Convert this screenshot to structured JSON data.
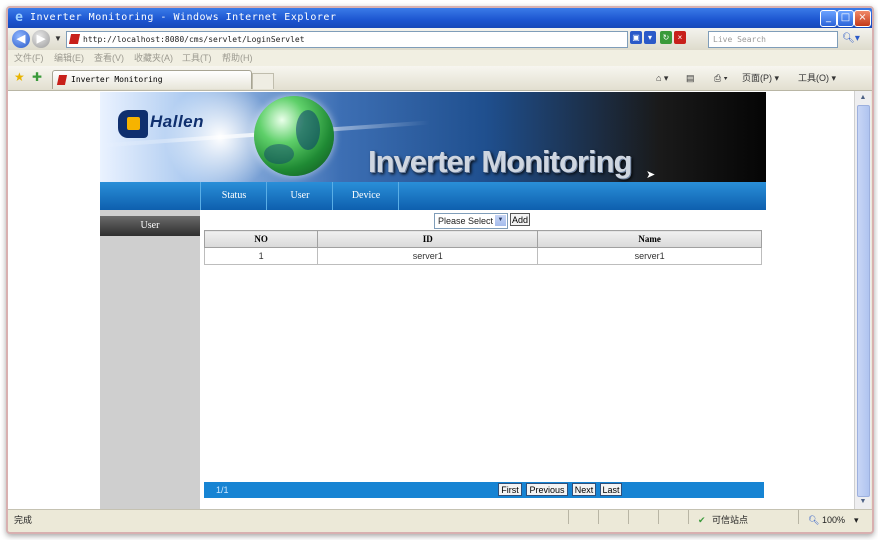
{
  "window": {
    "title": "Inverter Monitoring - Windows Internet Explorer",
    "minimize": "_",
    "maximize": "□",
    "close": "×"
  },
  "address": {
    "url": "http://localhost:8080/cms/servlet/LoginServlet",
    "search_placeholder": "Live Search"
  },
  "menu": {
    "items": [
      "文件(F)",
      "编辑(E)",
      "查看(V)",
      "收藏夹(A)",
      "工具(T)",
      "帮助(H)"
    ]
  },
  "tab": {
    "label": "Inverter Monitoring"
  },
  "commands": {
    "page": "页面(P) ▾",
    "tools": "工具(O) ▾"
  },
  "banner": {
    "brand": "Hallen",
    "title": "Inverter Monitoring"
  },
  "nav": {
    "items": [
      "Status",
      "User",
      "Device"
    ]
  },
  "sidebar": {
    "items": [
      "User"
    ]
  },
  "toolbar": {
    "select_value": "Please Select",
    "add_label": "Add"
  },
  "table": {
    "columns": [
      "NO",
      "ID",
      "Name"
    ],
    "rows": [
      [
        "1",
        "server1",
        "server1"
      ]
    ]
  },
  "pager": {
    "info": "1/1",
    "first": "First",
    "previous": "Previous",
    "next": "Next",
    "last": "Last"
  },
  "status": {
    "left": "完成",
    "zone": "可信站点",
    "zoom": "100%"
  },
  "colors": {
    "titlebar": "#1c55d0",
    "nav": "#1784d3",
    "sidebar": "#cfcfcf",
    "sidebar_item": "#3a3a3a"
  }
}
